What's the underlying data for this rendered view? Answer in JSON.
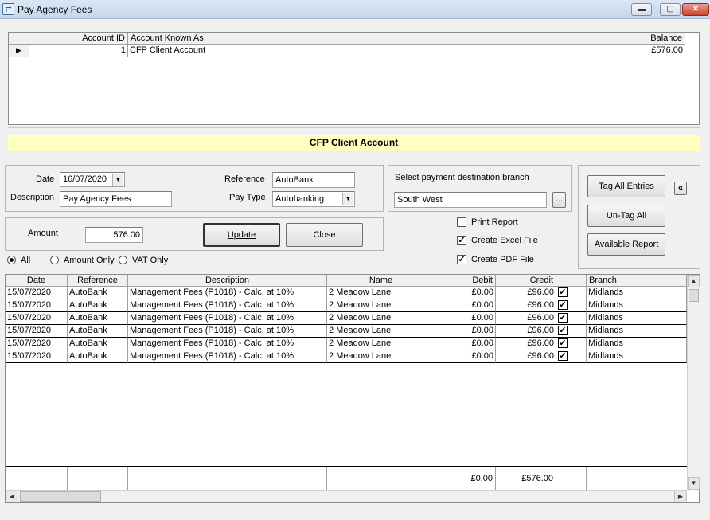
{
  "window": {
    "title": "Pay Agency Fees",
    "minimize": "▬",
    "maximize": "▢",
    "close": "✕"
  },
  "accounts": {
    "columns": [
      "Account ID",
      "Account Known As",
      "Balance"
    ],
    "rows": [
      {
        "selector": "▶",
        "id": "1",
        "name": "CFP Client Account",
        "balance": "£576.00"
      }
    ]
  },
  "banner": {
    "text": "CFP Client Account",
    "color": "#ffffc0"
  },
  "details": {
    "date_label": "Date",
    "date_value": "16/07/2020",
    "description_label": "Description",
    "description_value": "Pay Agency Fees",
    "reference_label": "Reference",
    "reference_value": "AutoBank",
    "paytype_label": "Pay Type",
    "paytype_value": "Autobanking"
  },
  "branch": {
    "label": "Select payment destination branch",
    "value": "South West",
    "browse": "..."
  },
  "amount": {
    "label": "Amount",
    "value": "576.00",
    "update_button": "Update",
    "close_button": "Close"
  },
  "options": {
    "print_report": {
      "label": "Print Report",
      "checked": false
    },
    "create_excel": {
      "label": "Create Excel File",
      "checked": true
    },
    "create_pdf": {
      "label": "Create PDF File",
      "checked": true
    }
  },
  "tag_buttons": {
    "tag_all": "Tag All Entries",
    "untag_all": "Un-Tag All",
    "available_report": "Available Report",
    "collapse": "«"
  },
  "filter": {
    "all": "All",
    "amount_only": "Amount Only",
    "vat_only": "VAT Only",
    "selected": "all"
  },
  "entries": {
    "columns": [
      "Date",
      "Reference",
      "Description",
      "Name",
      "Debit",
      "Credit",
      "",
      "Branch"
    ],
    "rows": [
      {
        "date": "15/07/2020",
        "reference": "AutoBank",
        "description": "Management Fees (P1018) - Calc. at 10%",
        "name": "2 Meadow Lane",
        "debit": "£0.00",
        "credit": "£96.00",
        "tagged": true,
        "branch": "Midlands"
      },
      {
        "date": "15/07/2020",
        "reference": "AutoBank",
        "description": "Management Fees (P1018) - Calc. at 10%",
        "name": "2 Meadow Lane",
        "debit": "£0.00",
        "credit": "£96.00",
        "tagged": true,
        "branch": "Midlands"
      },
      {
        "date": "15/07/2020",
        "reference": "AutoBank",
        "description": "Management Fees (P1018) - Calc. at 10%",
        "name": "2 Meadow Lane",
        "debit": "£0.00",
        "credit": "£96.00",
        "tagged": true,
        "branch": "Midlands"
      },
      {
        "date": "15/07/2020",
        "reference": "AutoBank",
        "description": "Management Fees (P1018) - Calc. at 10%",
        "name": "2 Meadow Lane",
        "debit": "£0.00",
        "credit": "£96.00",
        "tagged": true,
        "branch": "Midlands"
      },
      {
        "date": "15/07/2020",
        "reference": "AutoBank",
        "description": "Management Fees (P1018) - Calc. at 10%",
        "name": "2 Meadow Lane",
        "debit": "£0.00",
        "credit": "£96.00",
        "tagged": true,
        "branch": "Midlands"
      },
      {
        "date": "15/07/2020",
        "reference": "AutoBank",
        "description": "Management Fees (P1018) - Calc. at 10%",
        "name": "2 Meadow Lane",
        "debit": "£0.00",
        "credit": "£96.00",
        "tagged": true,
        "branch": "Midlands"
      }
    ],
    "totals": {
      "debit": "£0.00",
      "credit": "£576.00"
    }
  }
}
